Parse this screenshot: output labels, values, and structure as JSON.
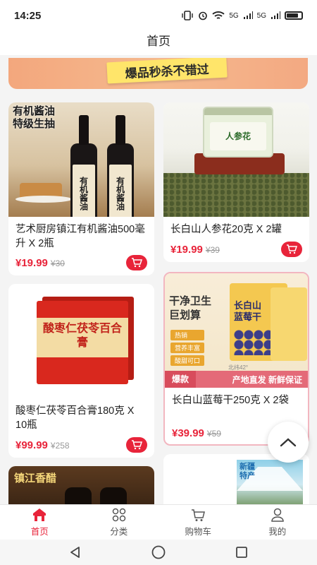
{
  "status": {
    "time": "14:25",
    "signal1": "5G",
    "signal2": "5G"
  },
  "nav": {
    "title": "首页"
  },
  "banner": {
    "text": "爆品秒杀不错过"
  },
  "products": [
    {
      "title": "艺术厨房镇江有机酱油500毫升 X 2瓶",
      "price": "¥19.99",
      "orig": "¥30",
      "image_text": [
        "有机酱油",
        "特级生抽"
      ],
      "label_text": "有机酱油"
    },
    {
      "title": "长白山人参花20克 X 2罐",
      "price": "¥19.99",
      "orig": "¥39",
      "image_text": "人参花"
    },
    {
      "title": "酸枣仁茯苓百合膏180克 X 10瓶",
      "price": "¥99.99",
      "orig": "¥258",
      "image_text": "酸枣仁茯苓百合膏"
    },
    {
      "title": "长白山蓝莓干250克 X 2袋",
      "price": "¥39.99",
      "orig": "¥59",
      "image_text": [
        "干净卫生",
        "巨划算",
        "长白山",
        "蓝莓干",
        "热销",
        "营养丰富",
        "酸甜可口",
        "北纬42°"
      ],
      "badge": "爆款",
      "tagline": "产地直发 新鲜保证"
    },
    {
      "title": "",
      "price": "",
      "orig": "",
      "image_text": "镇江香醋"
    },
    {
      "title": "",
      "price": "",
      "orig": "",
      "image_text": [
        "新疆",
        "特产"
      ]
    }
  ],
  "tabs": [
    {
      "label": "首页",
      "icon": "home-icon",
      "active": true
    },
    {
      "label": "分类",
      "icon": "category-icon",
      "active": false
    },
    {
      "label": "购物车",
      "icon": "cart-icon",
      "active": false
    },
    {
      "label": "我的",
      "icon": "profile-icon",
      "active": false
    }
  ],
  "colors": {
    "accent": "#e8243a",
    "background": "#f4f4f4"
  }
}
